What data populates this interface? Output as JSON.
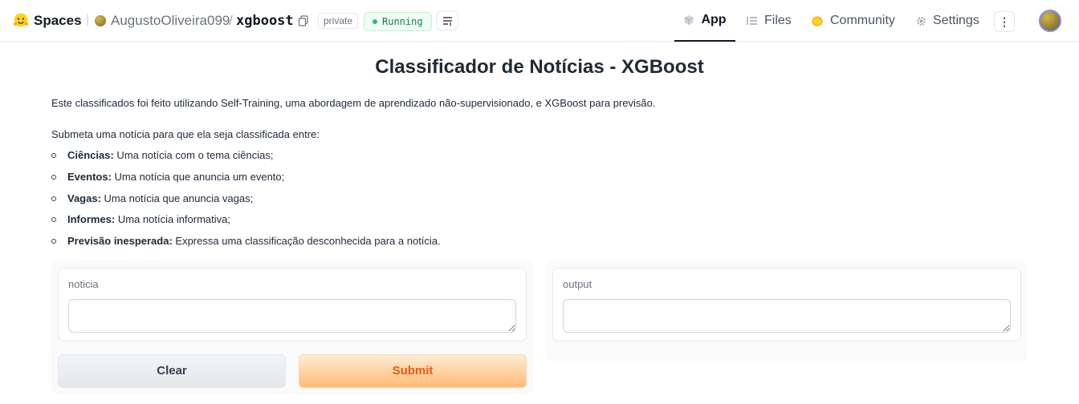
{
  "header": {
    "brand": "Spaces",
    "owner": "AugustoOliveira099",
    "separator": "/",
    "repo": "xgboost",
    "visibility_badge": "private",
    "status_badge": "Running",
    "nav": {
      "app": "App",
      "files": "Files",
      "community": "Community",
      "settings": "Settings"
    }
  },
  "main": {
    "title": "Classificador de Notícias - XGBoost",
    "description": "Este classificados foi feito utilizando Self-Training, uma abordagem de aprendizado não-supervisionado, e XGBoost para previsão.",
    "intro": "Submeta uma notícia para que ela seja classificada entre:",
    "categories": [
      {
        "name": "Ciências:",
        "text": " Uma notícia com o tema ciências;"
      },
      {
        "name": "Eventos:",
        "text": " Uma notícia que anuncia um evento;"
      },
      {
        "name": "Vagas:",
        "text": " Uma notícia que anuncia vagas;"
      },
      {
        "name": "Informes:",
        "text": " Uma notícia informativa;"
      },
      {
        "name": "Previsão inesperada:",
        "text": " Expressa uma classificação desconhecida para a notícia."
      }
    ]
  },
  "input_panel": {
    "label": "noticia",
    "value": "",
    "clear_label": "Clear",
    "submit_label": "Submit"
  },
  "output_panel": {
    "label": "output",
    "value": ""
  },
  "colors": {
    "accent": "#ea580c",
    "running": "#22c55e"
  }
}
